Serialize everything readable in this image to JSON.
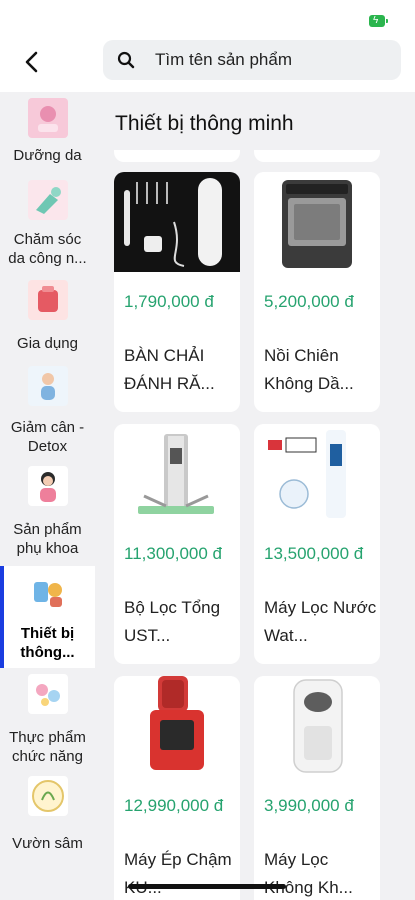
{
  "status": {
    "battery_icon": "battery-charging-icon",
    "battery_color": "#2bb54e"
  },
  "header": {
    "back_icon": "chevron-left-icon",
    "search": {
      "placeholder": "Tìm tên sản phẩm",
      "icon": "search-icon"
    }
  },
  "sidebar": {
    "items": [
      {
        "label": "Dưỡng da"
      },
      {
        "label": "Chăm sóc da công n..."
      },
      {
        "label": "Gia dụng"
      },
      {
        "label": "Giảm cân - Detox"
      },
      {
        "label": "Sản phẩm phụ khoa"
      },
      {
        "label": "Thiết bị thông...",
        "active": true
      },
      {
        "label": "Thực phẩm chức năng"
      },
      {
        "label": "Vườn sâm"
      }
    ],
    "active_color": "#1a3de0"
  },
  "main": {
    "title": "Thiết bị thông minh",
    "products": [
      {
        "price": "1,790,000 đ",
        "name": "BÀN CHẢI ĐÁNH RĂ..."
      },
      {
        "price": "5,200,000 đ",
        "name": "Nồi Chiên Không Dầ..."
      },
      {
        "price": "11,300,000 đ",
        "name": "Bộ Lọc Tổng UST..."
      },
      {
        "price": "13,500,000 đ",
        "name": "Máy Lọc Nước Wat..."
      },
      {
        "price": "12,990,000 đ",
        "name": "Máy Ép Chậm KU..."
      },
      {
        "price": "3,990,000 đ",
        "name": "Máy Lọc Không Kh..."
      }
    ],
    "price_color": "#26a36f"
  }
}
